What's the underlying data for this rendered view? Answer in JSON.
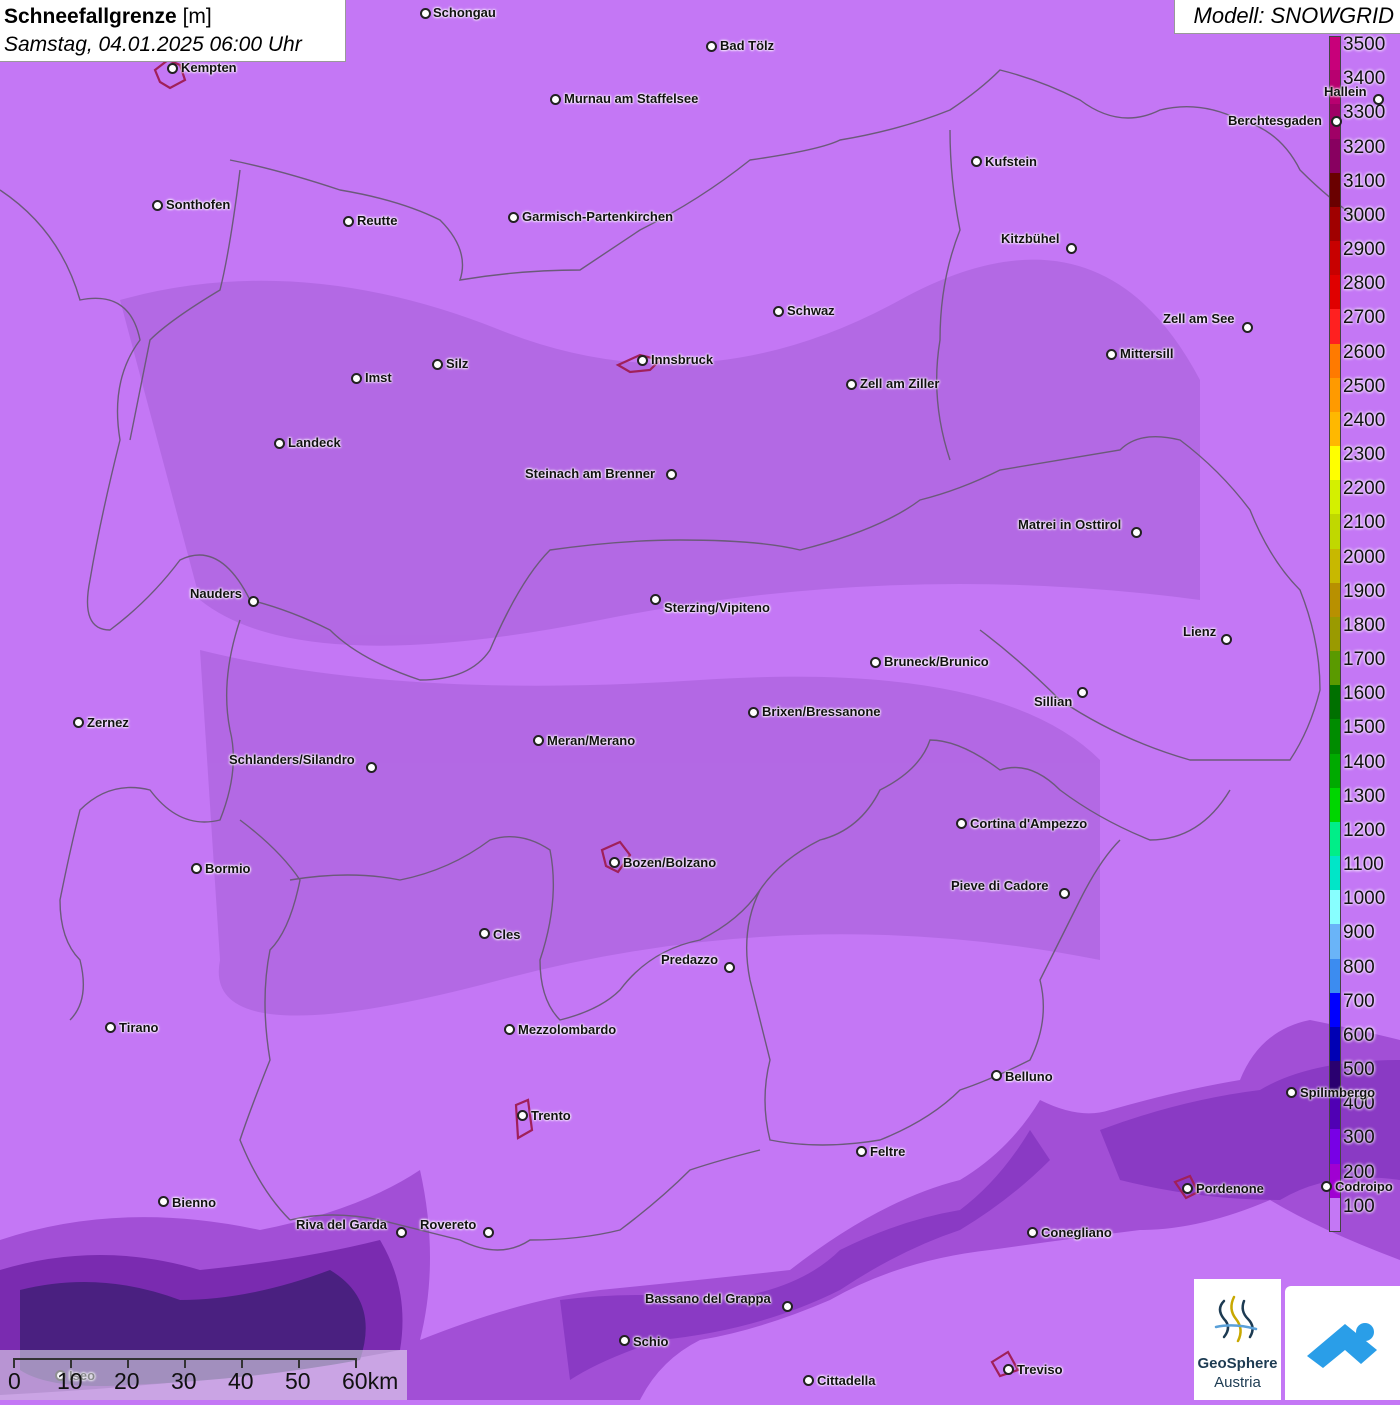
{
  "header": {
    "title": "Schneefallgrenze",
    "unit": "[m]",
    "datetime": "Samstag, 04.01.2025 06:00 Uhr",
    "model": "Modell: SNOWGRID"
  },
  "legend": {
    "items": [
      {
        "value": "3500",
        "color": "#c8007a"
      },
      {
        "value": "3400",
        "color": "#b80070"
      },
      {
        "value": "3300",
        "color": "#a00066"
      },
      {
        "value": "3200",
        "color": "#880060"
      },
      {
        "value": "3100",
        "color": "#6a0000"
      },
      {
        "value": "3000",
        "color": "#a00000"
      },
      {
        "value": "2900",
        "color": "#c80000"
      },
      {
        "value": "2800",
        "color": "#e00000"
      },
      {
        "value": "2700",
        "color": "#ff2020"
      },
      {
        "value": "2600",
        "color": "#ff7a00"
      },
      {
        "value": "2500",
        "color": "#ff9a00"
      },
      {
        "value": "2400",
        "color": "#ffb800"
      },
      {
        "value": "2300",
        "color": "#ffff00"
      },
      {
        "value": "2200",
        "color": "#d4f000"
      },
      {
        "value": "2100",
        "color": "#c0d800"
      },
      {
        "value": "2000",
        "color": "#c8b800"
      },
      {
        "value": "1900",
        "color": "#b89000"
      },
      {
        "value": "1800",
        "color": "#9a9a00"
      },
      {
        "value": "1700",
        "color": "#5a9a00"
      },
      {
        "value": "1600",
        "color": "#007000"
      },
      {
        "value": "1500",
        "color": "#008c00"
      },
      {
        "value": "1400",
        "color": "#00aa00"
      },
      {
        "value": "1300",
        "color": "#00d600"
      },
      {
        "value": "1200",
        "color": "#00ee88"
      },
      {
        "value": "1100",
        "color": "#00e6c8"
      },
      {
        "value": "1000",
        "color": "#88ffff"
      },
      {
        "value": "900",
        "color": "#6ab4f8"
      },
      {
        "value": "800",
        "color": "#3c8cf0"
      },
      {
        "value": "700",
        "color": "#0000ff"
      },
      {
        "value": "600",
        "color": "#0000b4"
      },
      {
        "value": "500",
        "color": "#2a0070"
      },
      {
        "value": "400",
        "color": "#5000b4"
      },
      {
        "value": "300",
        "color": "#7800e6"
      },
      {
        "value": "200",
        "color": "#a000d2"
      },
      {
        "value": "100",
        "color": "#c477f5"
      }
    ]
  },
  "map": {
    "fill_color": "#c477f5",
    "cities": [
      {
        "name": "Schongau"
      },
      {
        "name": "Bad Tölz"
      },
      {
        "name": "Kempten"
      },
      {
        "name": "Murnau am Staffelsee"
      },
      {
        "name": "Hallein"
      },
      {
        "name": "Berchtesgaden"
      },
      {
        "name": "Kufstein"
      },
      {
        "name": "Sonthofen"
      },
      {
        "name": "Reutte"
      },
      {
        "name": "Garmisch-Partenkirchen"
      },
      {
        "name": "Kitzbühel"
      },
      {
        "name": "Schwaz"
      },
      {
        "name": "Zell am See"
      },
      {
        "name": "Innsbruck"
      },
      {
        "name": "Silz"
      },
      {
        "name": "Mittersill"
      },
      {
        "name": "Imst"
      },
      {
        "name": "Zell am Ziller"
      },
      {
        "name": "Landeck"
      },
      {
        "name": "Steinach am Brenner"
      },
      {
        "name": "Matrei in Osttirol"
      },
      {
        "name": "Nauders"
      },
      {
        "name": "Sterzing/Vipiteno"
      },
      {
        "name": "Lienz"
      },
      {
        "name": "Bruneck/Brunico"
      },
      {
        "name": "Sillian"
      },
      {
        "name": "Brixen/Bressanone"
      },
      {
        "name": "Zernez"
      },
      {
        "name": "Meran/Merano"
      },
      {
        "name": "Schlanders/Silandro"
      },
      {
        "name": "Cortina d'Ampezzo"
      },
      {
        "name": "Bozen/Bolzano"
      },
      {
        "name": "Bormio"
      },
      {
        "name": "Pieve di Cadore"
      },
      {
        "name": "Cles"
      },
      {
        "name": "Predazzo"
      },
      {
        "name": "Tirano"
      },
      {
        "name": "Mezzolombardo"
      },
      {
        "name": "Belluno"
      },
      {
        "name": "Spilimbergo"
      },
      {
        "name": "Trento"
      },
      {
        "name": "Feltre"
      },
      {
        "name": "Pordenone"
      },
      {
        "name": "Codroipo"
      },
      {
        "name": "Bienno"
      },
      {
        "name": "Riva del Garda"
      },
      {
        "name": "Rovereto"
      },
      {
        "name": "Conegliano"
      },
      {
        "name": "Bassano del Grappa"
      },
      {
        "name": "Schio"
      },
      {
        "name": "Treviso"
      },
      {
        "name": "Cittadella"
      },
      {
        "name": "Iseo"
      }
    ]
  },
  "scale": {
    "labels": [
      "0",
      "10",
      "20",
      "30",
      "40",
      "50",
      "60km"
    ]
  },
  "logos": {
    "brand_line1": "GeoSphere",
    "brand_line2": "Austria"
  }
}
